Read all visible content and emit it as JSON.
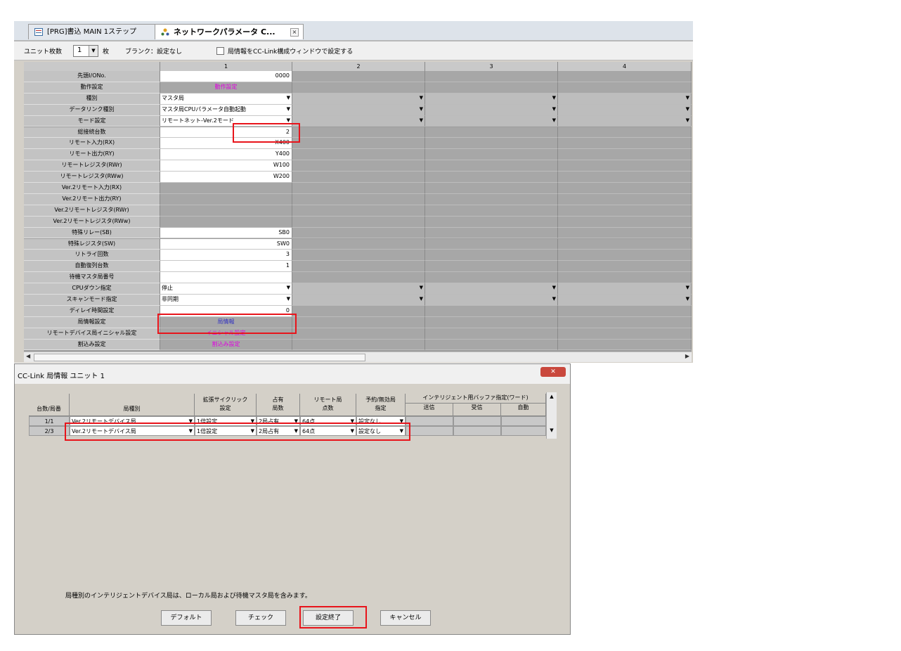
{
  "tabs": [
    {
      "label": "[PRG]書込 MAIN 1ステップ"
    },
    {
      "label": "ネットワークパラメータ C..."
    }
  ],
  "options_bar": {
    "unit_count_label": "ユニット枚数",
    "unit_count_value": "1",
    "unit_suffix": "枚",
    "blank_label": "ブランク：設定なし",
    "checkbox_label": "局情報をCC-Link構成ウィンドウで設定する"
  },
  "grid": {
    "column_headers": [
      "1",
      "2",
      "3",
      "4"
    ],
    "rows": [
      {
        "label": "先頭I/ONo.",
        "value": "0000",
        "kind": "text-right"
      },
      {
        "label": "動作設定",
        "value": "動作設定",
        "kind": "link-magenta"
      },
      {
        "label": "種別",
        "value": "マスタ局",
        "kind": "dropdown"
      },
      {
        "label": "データリンク種別",
        "value": "マスタ局CPUパラメータ自動起動",
        "kind": "dropdown"
      },
      {
        "label": "モード設定",
        "value": "リモートネット-Ver.2モード",
        "kind": "dropdown"
      },
      {
        "label": "総接続台数",
        "value": "2",
        "kind": "text-right"
      },
      {
        "label": "リモート入力(RX)",
        "value": "X400",
        "kind": "text-right"
      },
      {
        "label": "リモート出力(RY)",
        "value": "Y400",
        "kind": "text-right"
      },
      {
        "label": "リモートレジスタ(RWr)",
        "value": "W100",
        "kind": "text-right"
      },
      {
        "label": "リモートレジスタ(RWw)",
        "value": "W200",
        "kind": "text-right"
      },
      {
        "label": "Ver.2リモート入力(RX)",
        "value": "",
        "kind": "grey"
      },
      {
        "label": "Ver.2リモート出力(RY)",
        "value": "",
        "kind": "grey"
      },
      {
        "label": "Ver.2リモートレジスタ(RWr)",
        "value": "",
        "kind": "grey"
      },
      {
        "label": "Ver.2リモートレジスタ(RWw)",
        "value": "",
        "kind": "grey"
      },
      {
        "label": "特殊リレー(SB)",
        "value": "SB0",
        "kind": "text-right"
      },
      {
        "label": "特殊レジスタ(SW)",
        "value": "SW0",
        "kind": "text-right"
      },
      {
        "label": "リトライ回数",
        "value": "3",
        "kind": "text-right"
      },
      {
        "label": "自動復列台数",
        "value": "1",
        "kind": "text-right"
      },
      {
        "label": "待機マスタ局番号",
        "value": "",
        "kind": "text-right"
      },
      {
        "label": "CPUダウン指定",
        "value": "停止",
        "kind": "dropdown"
      },
      {
        "label": "スキャンモード指定",
        "value": "非同期",
        "kind": "dropdown"
      },
      {
        "label": "ディレイ時間設定",
        "value": "0",
        "kind": "text-right"
      },
      {
        "label": "局情報設定",
        "value": "局情報",
        "kind": "link-blue"
      },
      {
        "label": "リモートデバイス局イニシャル設定",
        "value": "イニシャル設定",
        "kind": "link-magenta"
      },
      {
        "label": "割込み設定",
        "value": "割込み設定",
        "kind": "link-magenta"
      }
    ]
  },
  "dialog": {
    "title": "CC-Link 局情報 ユニット 1",
    "headers": {
      "unit_station": "台数/局番",
      "station_type": "局種別",
      "cyclic": [
        "拡張サイクリック",
        "設定"
      ],
      "occupied": [
        "占有",
        "局数"
      ],
      "remote_points": [
        "リモート局",
        "点数"
      ],
      "reserved": [
        "予約/無効局",
        "指定"
      ],
      "buffer": "インテリジェント用バッファ指定(ワード)",
      "buffer_sub": [
        "送信",
        "受信",
        "自動"
      ]
    },
    "rows": [
      {
        "no": "1/1",
        "type": "Ver.2リモートデバイス局",
        "cyclic": "1倍設定",
        "occupied": "2局占有",
        "points": "64点",
        "reserved": "設定なし"
      },
      {
        "no": "2/3",
        "type": "Ver.2リモートデバイス局",
        "cyclic": "1倍設定",
        "occupied": "2局占有",
        "points": "64点",
        "reserved": "設定なし"
      }
    ],
    "note": "局種別のインテリジェントデバイス局は、ローカル局および待機マスタ局を含みます。",
    "buttons": {
      "default": "デフォルト",
      "check": "チェック",
      "finish": "設定終了",
      "cancel": "キャンセル"
    }
  },
  "highlight_color": "#e8141b"
}
